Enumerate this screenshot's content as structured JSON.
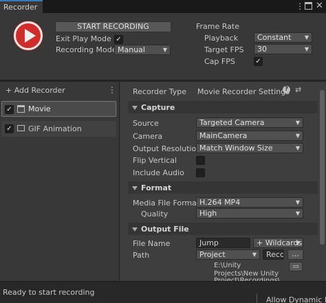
{
  "window": {
    "tab_label": "Recorder",
    "menu_icon": "kebab-icon",
    "maximize_icon": "window-icon",
    "close_icon": "close-icon"
  },
  "controls": {
    "start_recording_label": "START RECORDING",
    "exit_play_mode_label": "Exit Play Mode",
    "exit_play_mode_checked": true,
    "recording_mode_label": "Recording Mode",
    "recording_mode_value": "Manual"
  },
  "frame_rate": {
    "title": "Frame Rate",
    "playback_label": "Playback",
    "playback_value": "Constant",
    "target_fps_label": "Target FPS",
    "target_fps_value": "30",
    "cap_fps_label": "Cap FPS",
    "cap_fps_checked": true
  },
  "recorder_list": {
    "add_label": "+ Add Recorder",
    "items": [
      {
        "label": "Movie",
        "checked": true,
        "selected": true,
        "icon": "film-icon"
      },
      {
        "label": "GIF Animation",
        "checked": true,
        "selected": false,
        "icon": "image-icon"
      }
    ]
  },
  "inspector": {
    "recorder_type_label": "Recorder Type",
    "recorder_type_value": "Movie Recorder Settings",
    "capture": {
      "title": "Capture",
      "source_label": "Source",
      "source_value": "Targeted Camera",
      "camera_label": "Camera",
      "camera_value": "MainCamera",
      "output_resolution_label": "Output Resolution",
      "output_resolution_value": "Match Window Size",
      "flip_vertical_label": "Flip Vertical",
      "flip_vertical_checked": false,
      "include_audio_label": "Include Audio",
      "include_audio_checked": false
    },
    "format": {
      "title": "Format",
      "media_file_format_label": "Media File Format",
      "media_file_format_value": "H.264 MP4",
      "quality_label": "Quality",
      "quality_value": "High"
    },
    "output_file": {
      "title": "Output File",
      "file_name_label": "File Name",
      "file_name_value": "Jump",
      "wildcards_label": "+ Wildcards",
      "path_label": "Path",
      "path_value": "Project",
      "path_field_value": "Reco",
      "browse_label": "...",
      "path_preview_line1": "E:\\Unity",
      "path_preview_line2": "Projects\\New Unity",
      "path_preview_line3": "Project\\Recordings\\"
    }
  },
  "status": {
    "text": "Ready to start recording",
    "right_text": "Allow Dynamic R"
  }
}
